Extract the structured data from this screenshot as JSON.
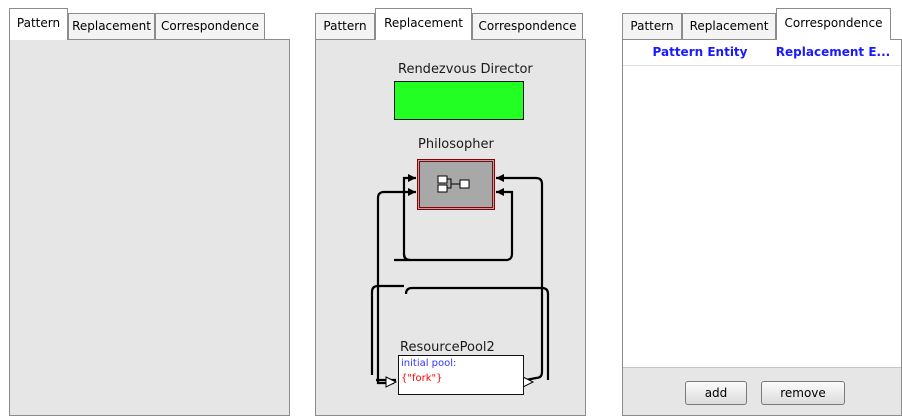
{
  "panels": [
    {
      "tabs": [
        "Pattern",
        "Replacement",
        "Correspondence"
      ],
      "active": "Pattern"
    },
    {
      "tabs": [
        "Pattern",
        "Replacement",
        "Correspondence"
      ],
      "active": "Replacement"
    },
    {
      "tabs": [
        "Pattern",
        "Replacement",
        "Correspondence"
      ],
      "active": "Correspondence"
    }
  ],
  "replacement_canvas": {
    "director_label": "Rendezvous Director",
    "actor_label": "Philosopher",
    "pool_label": "ResourcePool2",
    "pool_param_name": "initial pool:",
    "pool_param_value": "{\"fork\"}",
    "colors": {
      "director": "#22ff22",
      "actor_border": "#8b0000",
      "param_name": "#3333ff",
      "param_value": "#ff0000"
    }
  },
  "correspondence": {
    "columns": [
      "Pattern Entity",
      "Replacement E..."
    ],
    "add_label": "add",
    "remove_label": "remove"
  }
}
